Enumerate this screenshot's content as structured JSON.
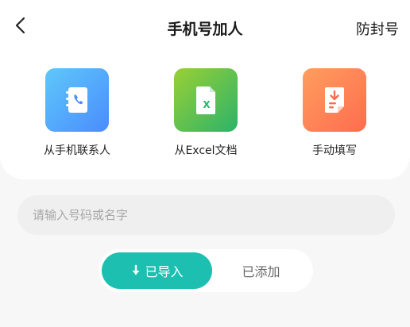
{
  "header": {
    "back_icon": "chevron-left-icon",
    "title": "手机号加人",
    "right_action": "防封号"
  },
  "options": [
    {
      "label": "从手机联系人",
      "icon": "contacts-book-icon",
      "color": "#4a8cfc"
    },
    {
      "label": "从Excel文档",
      "icon": "excel-file-icon",
      "color": "#2bb36a"
    },
    {
      "label": "手动填写",
      "icon": "manual-entry-icon",
      "color": "#ff6c4f"
    }
  ],
  "search": {
    "placeholder": "请输入号码或名字",
    "value": ""
  },
  "tabs": {
    "imported_label": "已导入",
    "added_label": "已添加",
    "active": "已导入",
    "accent": "#1dbfb1"
  }
}
